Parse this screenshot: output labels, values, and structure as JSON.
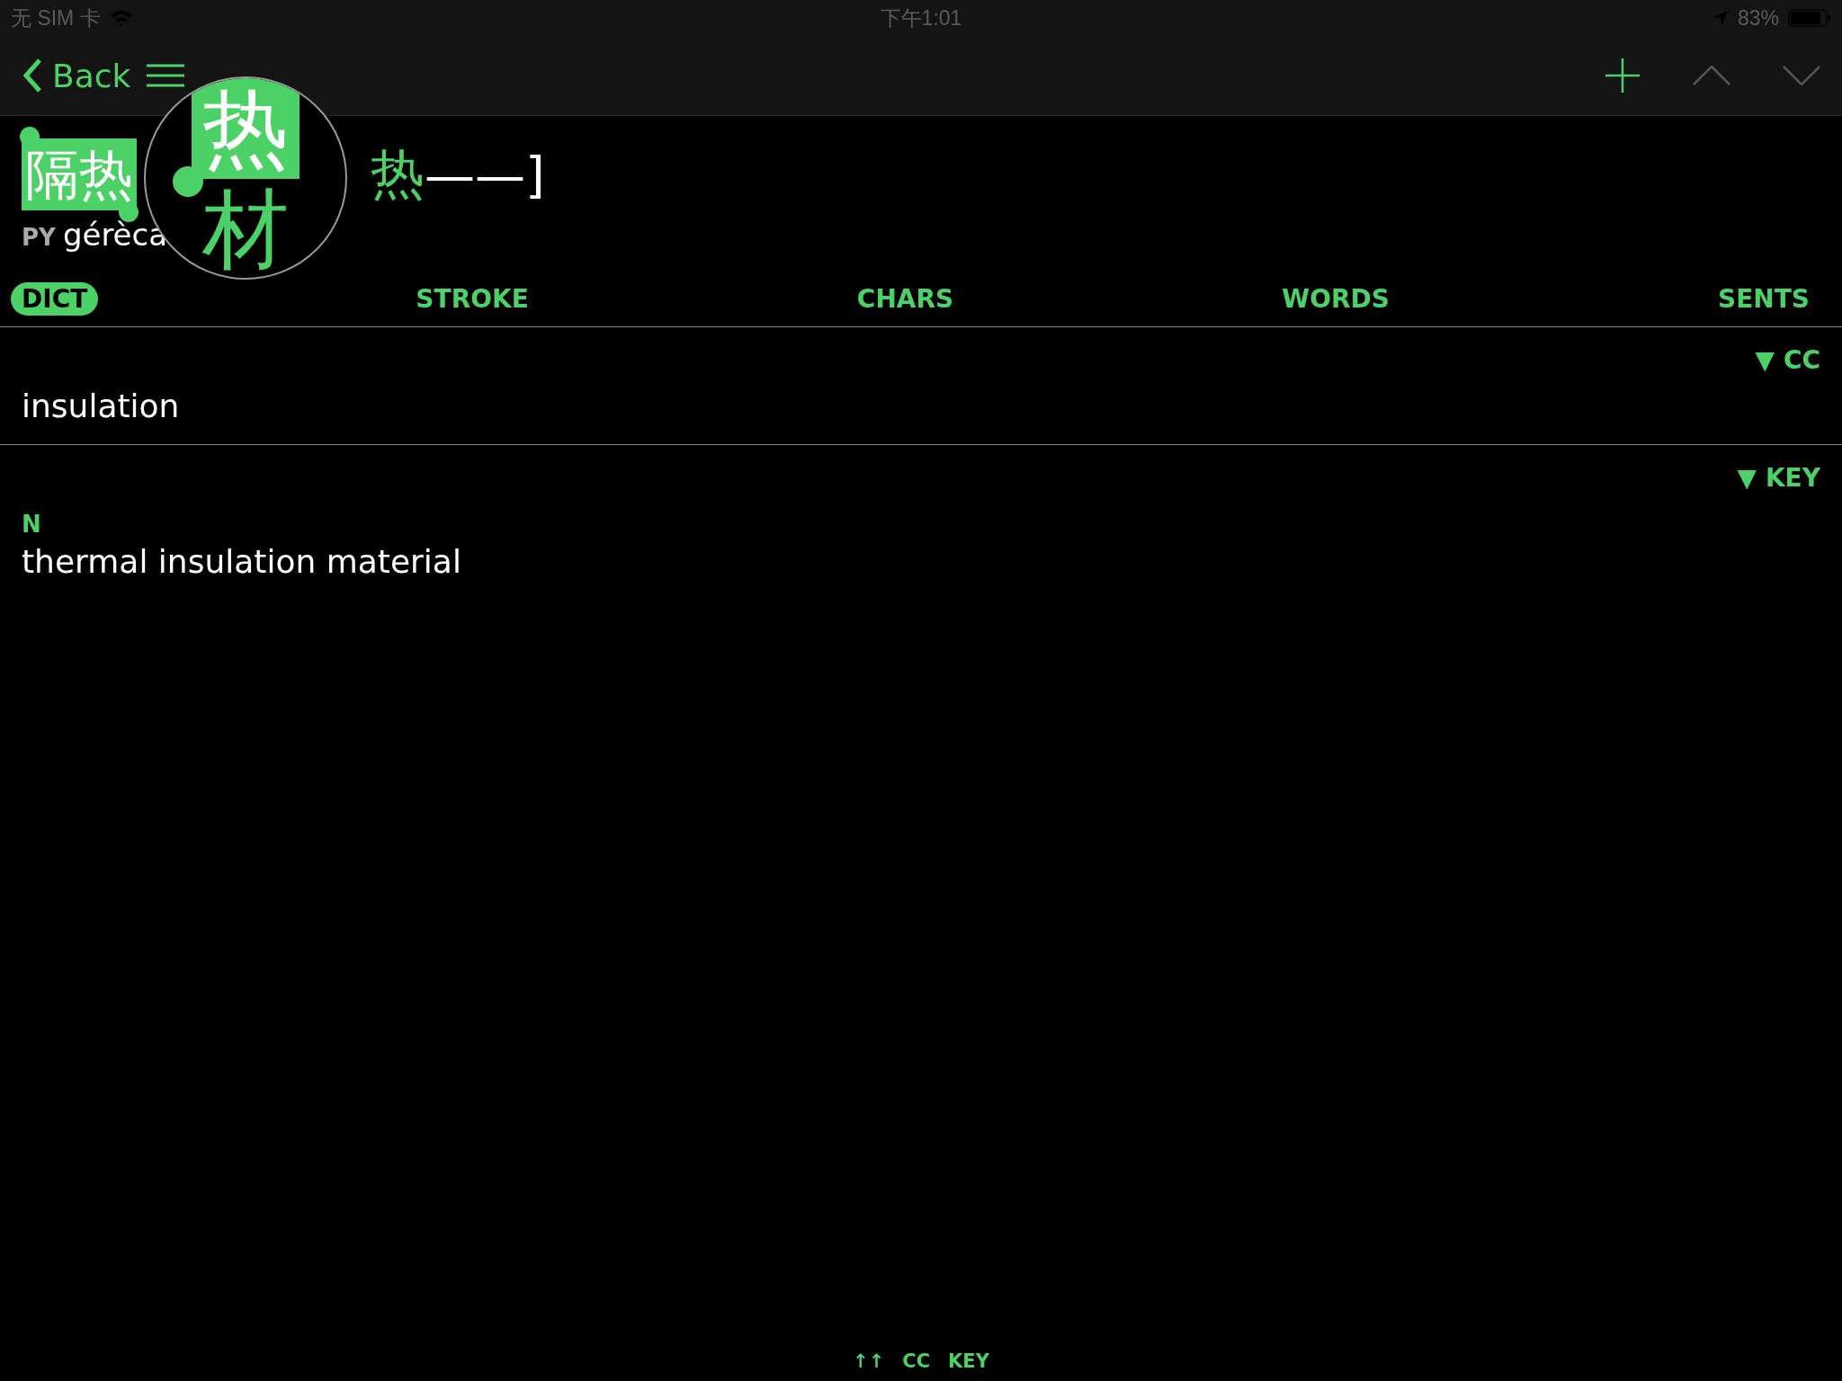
{
  "status_bar": {
    "carrier": "无 SIM 卡",
    "time": "下午1:01",
    "battery": "83%"
  },
  "nav": {
    "back": "Back"
  },
  "entry": {
    "headword_selected": "隔热",
    "headword_trailing": "热",
    "bracket": "——]",
    "pinyin_label": "PY",
    "pinyin": "gérèca",
    "loupe": {
      "chars": [
        "热",
        "材"
      ]
    }
  },
  "tabs": [
    {
      "label": "DICT",
      "selected": true
    },
    {
      "label": "STROKE",
      "selected": false
    },
    {
      "label": "CHARS",
      "selected": false
    },
    {
      "label": "WORDS",
      "selected": false
    },
    {
      "label": "SENTS",
      "selected": false
    }
  ],
  "sections": [
    {
      "source": "▼ CC",
      "definition": "insulation"
    },
    {
      "source": "▼ KEY",
      "pos": "N",
      "definition": "thermal insulation material"
    }
  ],
  "footer": [
    "↑↑",
    "CC",
    "KEY"
  ]
}
